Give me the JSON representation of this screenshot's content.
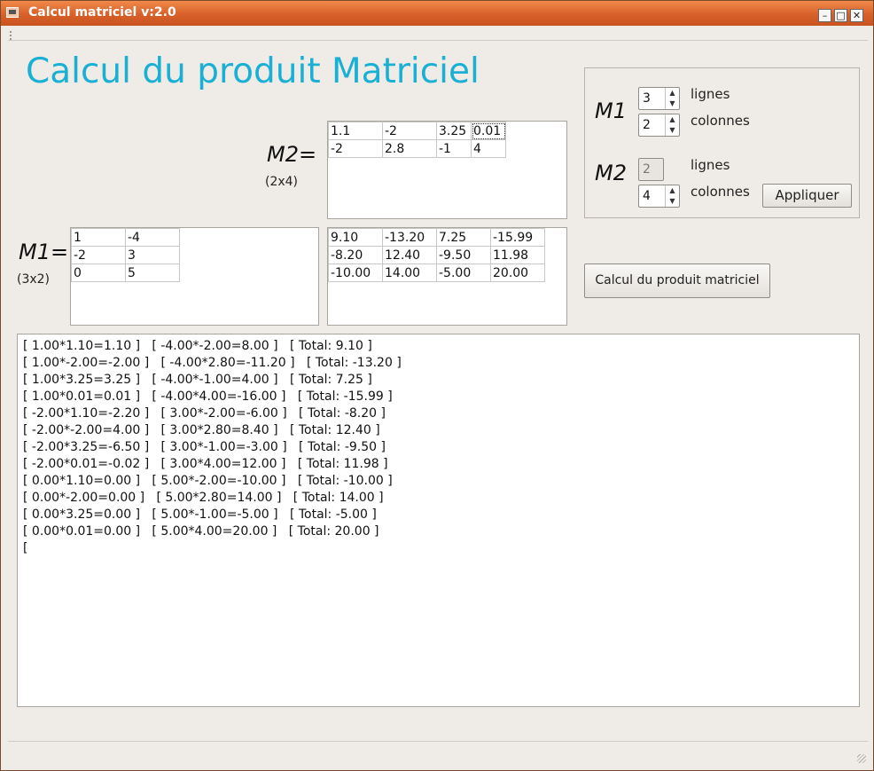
{
  "window": {
    "title": "Calcul matriciel v:2.0"
  },
  "heading": "Calcul du produit Matriciel",
  "m2": {
    "label": "M2=",
    "dims": "(2x4)",
    "cells": [
      [
        "1.1",
        "-2",
        "3.25",
        "0.01"
      ],
      [
        "-2",
        "2.8",
        "-1",
        "4"
      ]
    ]
  },
  "m1": {
    "label": "M1=",
    "dims": "(3x2)",
    "cells": [
      [
        "1",
        "-4"
      ],
      [
        "-2",
        "3"
      ],
      [
        "0",
        "5"
      ]
    ]
  },
  "result": {
    "cells": [
      [
        "9.10",
        "-13.20",
        "7.25",
        "-15.99"
      ],
      [
        "-8.20",
        "12.40",
        "-9.50",
        "11.98"
      ],
      [
        "-10.00",
        "14.00",
        "-5.00",
        "20.00"
      ]
    ]
  },
  "settings": {
    "m1_label": "M1",
    "m2_label": "M2",
    "m1_rows": "3",
    "m1_cols": "2",
    "m2_rows": "2",
    "m2_cols": "4",
    "rows_label": "lignes",
    "cols_label": "colonnes",
    "apply_label": "Appliquer"
  },
  "compute_label": "Calcul du produit matriciel",
  "log": [
    "[ 1.00*1.10=1.10 ]   [ -4.00*-2.00=8.00 ]   [ Total: 9.10 ]",
    "[ 1.00*-2.00=-2.00 ]   [ -4.00*2.80=-11.20 ]   [ Total: -13.20 ]",
    "[ 1.00*3.25=3.25 ]   [ -4.00*-1.00=4.00 ]   [ Total: 7.25 ]",
    "[ 1.00*0.01=0.01 ]   [ -4.00*4.00=-16.00 ]   [ Total: -15.99 ]",
    "[ -2.00*1.10=-2.20 ]   [ 3.00*-2.00=-6.00 ]   [ Total: -8.20 ]",
    "[ -2.00*-2.00=4.00 ]   [ 3.00*2.80=8.40 ]   [ Total: 12.40 ]",
    "[ -2.00*3.25=-6.50 ]   [ 3.00*-1.00=-3.00 ]   [ Total: -9.50 ]",
    "[ -2.00*0.01=-0.02 ]   [ 3.00*4.00=12.00 ]   [ Total: 11.98 ]",
    "[ 0.00*1.10=0.00 ]   [ 5.00*-2.00=-10.00 ]   [ Total: -10.00 ]",
    "[ 0.00*-2.00=0.00 ]   [ 5.00*2.80=14.00 ]   [ Total: 14.00 ]",
    "[ 0.00*3.25=0.00 ]   [ 5.00*-1.00=-5.00 ]   [ Total: -5.00 ]",
    "[ 0.00*0.01=0.00 ]   [ 5.00*4.00=20.00 ]   [ Total: 20.00 ]",
    "["
  ]
}
